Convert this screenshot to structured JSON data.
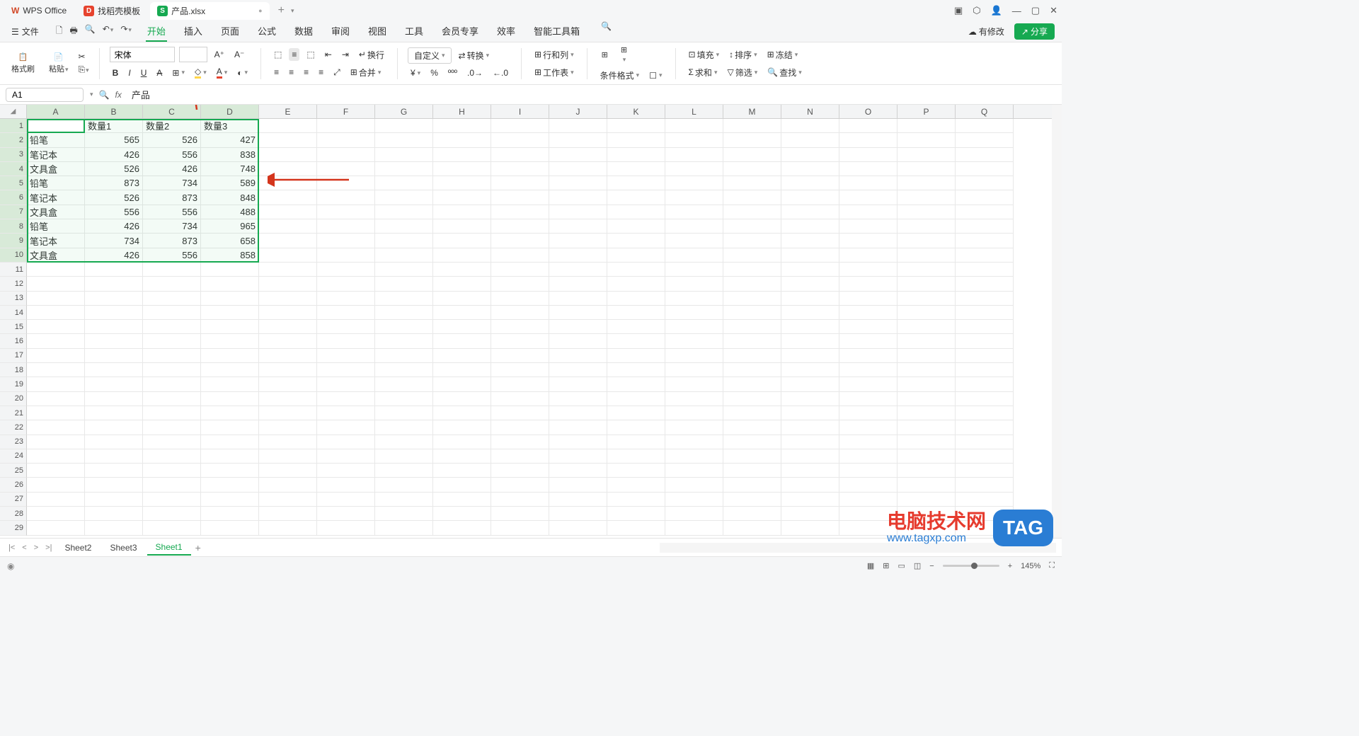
{
  "title_tabs": [
    {
      "icon_bg": "#d24726",
      "icon_text": "W",
      "label": "WPS Office"
    },
    {
      "icon_bg": "#e6432e",
      "icon_text": "D",
      "label": "找稻壳模板"
    },
    {
      "icon_bg": "#16a951",
      "icon_text": "S",
      "label": "产品.xlsx",
      "active": true,
      "dirty": "●"
    }
  ],
  "menu": {
    "file": "文件",
    "tabs": [
      "开始",
      "插入",
      "页面",
      "公式",
      "数据",
      "审阅",
      "视图",
      "工具",
      "会员专享",
      "效率",
      "智能工具箱"
    ],
    "active_tab": "开始",
    "modify": "有修改",
    "share": "分享"
  },
  "ribbon": {
    "format_brush": "格式刷",
    "paste": "粘贴",
    "font_name": "宋体",
    "wrap": "换行",
    "custom": "自定义",
    "convert": "转换",
    "row_col": "行和列",
    "worksheet": "工作表",
    "cond_format": "条件格式",
    "merge": "合并",
    "fill": "填充",
    "sort": "排序",
    "freeze": "冻结",
    "sum": "求和",
    "filter": "筛选",
    "find": "查找"
  },
  "formula_bar": {
    "cell_ref": "A1",
    "fx": "fx",
    "value": "产品"
  },
  "columns": [
    "A",
    "B",
    "C",
    "D",
    "E",
    "F",
    "G",
    "H",
    "I",
    "J",
    "K",
    "L",
    "M",
    "N",
    "O",
    "P",
    "Q"
  ],
  "headers": [
    "产品",
    "数量1",
    "数量2",
    "数量3"
  ],
  "rows": [
    [
      "铅笔",
      565,
      526,
      427
    ],
    [
      "笔记本",
      426,
      556,
      838
    ],
    [
      "文具盒",
      526,
      426,
      748
    ],
    [
      "铅笔",
      873,
      734,
      589
    ],
    [
      "笔记本",
      526,
      873,
      848
    ],
    [
      "文具盒",
      556,
      556,
      488
    ],
    [
      "铅笔",
      426,
      734,
      965
    ],
    [
      "笔记本",
      734,
      873,
      658
    ],
    [
      "文具盒",
      426,
      556,
      858
    ]
  ],
  "sheets": [
    "Sheet2",
    "Sheet3",
    "Sheet1"
  ],
  "active_sheet": "Sheet1",
  "status": {
    "zoom": "145%"
  },
  "watermark": {
    "line1": "电脑技术网",
    "url": "www.tagxp.com",
    "tag": "TAG"
  }
}
